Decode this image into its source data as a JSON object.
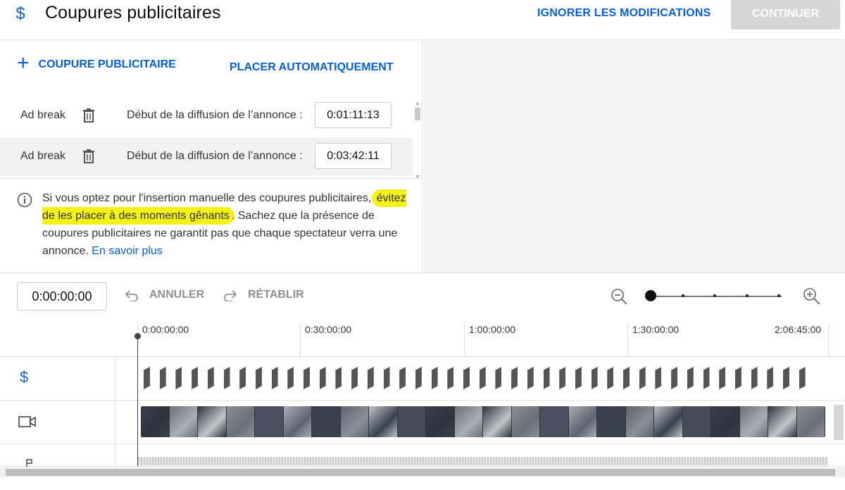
{
  "header": {
    "title": "Coupures publicitaires",
    "discard_label": "IGNORER LES MODIFICATIONS",
    "continue_label": "CONTINUER",
    "icon": "dollar-icon"
  },
  "actions": {
    "add_break_label": "COUPURE PUBLICITAIRE",
    "auto_place_label": "PLACER AUTOMATIQUEMENT"
  },
  "breaks": [
    {
      "label": "Ad break",
      "start_label": "Début de la diffusion de l’annonce :",
      "time": "0:01:11:13"
    },
    {
      "label": "Ad break",
      "start_label": "Début de la diffusion de l’annonce :",
      "time": "0:03:42:11"
    }
  ],
  "info": {
    "part1": "Si vous optez pour l'insertion manuelle des coupures publicitaires,",
    "highlight": "évitez de les placer à des moments gênants",
    "part2": ". Sachez que la présence de coupures publicitaires ne garantit pas que chaque spectateur verra une annonce.",
    "link": "En savoir plus"
  },
  "toolbar": {
    "timecode": "0:00:00:00",
    "undo_label": "ANNULER",
    "redo_label": "RÉTABLIR"
  },
  "ruler": {
    "labels": [
      "0:00:00:00",
      "0:30:00:00",
      "1:00:00:00",
      "1:30:00:00",
      "2:06:45:00"
    ]
  },
  "colors": {
    "accent": "#065fd4",
    "highlight": "#f4f01a",
    "disabled": "#d6d6d6"
  }
}
